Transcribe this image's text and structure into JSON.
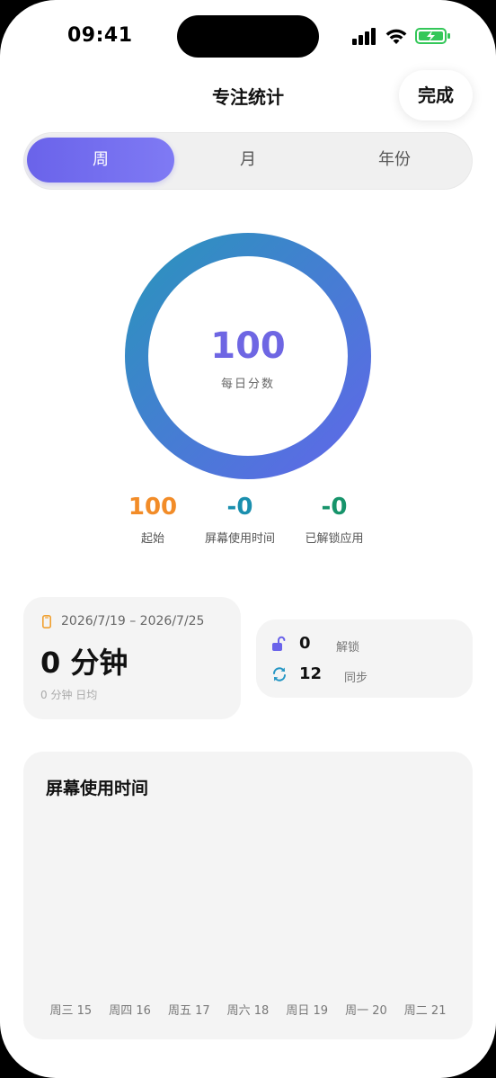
{
  "status_bar": {
    "time": "09:41"
  },
  "header": {
    "title": "专注统计",
    "done_label": "完成"
  },
  "tabs": [
    {
      "label": "周",
      "active": true
    },
    {
      "label": "月",
      "active": false
    },
    {
      "label": "年份",
      "active": false
    }
  ],
  "score": {
    "value": "100",
    "label": "每日分数",
    "ring_fraction": 1.0,
    "gradient_colors": [
      "#2b93bd",
      "#5f68e8"
    ]
  },
  "stats": [
    {
      "value": "100",
      "label": "起始",
      "color": "#f28c28"
    },
    {
      "value": "-0",
      "label": "屏幕使用时间",
      "color": "#1a8fae"
    },
    {
      "value": "-0",
      "label": "已解锁应用",
      "color": "#17946b"
    }
  ],
  "summary": {
    "date_range": "2026/7/19 – 2026/7/25",
    "total": "0 分钟",
    "daily_average": "0 分钟 日均"
  },
  "counts": {
    "unlocks_value": "0",
    "unlocks_label": "解锁",
    "syncs_value": "12",
    "syncs_label": "同步"
  },
  "chart_data": {
    "type": "bar",
    "title": "屏幕使用时间",
    "categories": [
      "周三 15",
      "周四 16",
      "周五 17",
      "周六 18",
      "周日 19",
      "周一 20",
      "周二 21"
    ],
    "values": [
      0,
      0,
      0,
      0,
      0,
      0,
      0
    ],
    "grid": false
  }
}
